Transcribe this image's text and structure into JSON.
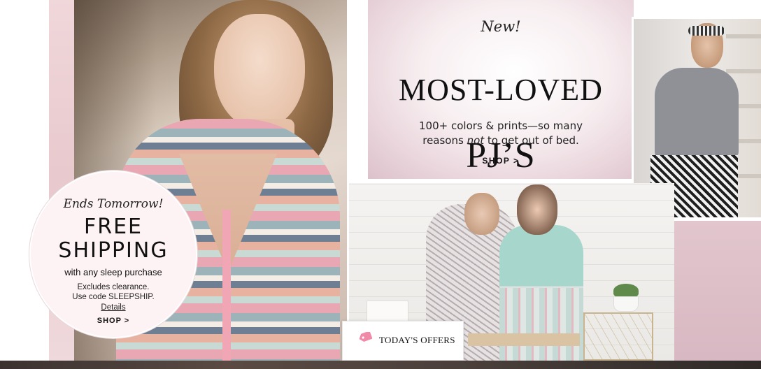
{
  "promo": {
    "eyebrow": "Ends Tomorrow!",
    "headline": "FREE\nSHIPPING",
    "subhead": "with any sleep purchase",
    "note": "Excludes clearance.\nUse code SLEEPSHIP.",
    "details_label": "Details",
    "shop_label": "SHOP >"
  },
  "hero": {
    "eyebrow": "New!",
    "title_line1": "MOST-LOVED",
    "title_line2": "PJ’S",
    "sub_before": "100+ colors & prints—so many",
    "sub_line2_a": "reasons ",
    "sub_line2_em": "not",
    "sub_line2_b": " to get out of bed.",
    "shop_label": "SHOP >"
  },
  "offers": {
    "label": "TODAY'S OFFERS",
    "icon": "tag-icon",
    "icon_color": "#f08aa8"
  },
  "colors": {
    "accent_pink": "#f08aa8",
    "panel_pink": "#e7d1d8"
  }
}
